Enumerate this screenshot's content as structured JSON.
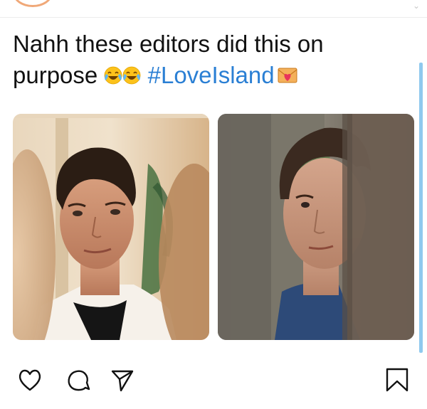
{
  "post": {
    "caption_text": "Nahh these editors did this on purpose",
    "hashtag": "#LoveIsland",
    "emojis": [
      "face-with-tears-of-joy-icon",
      "face-with-tears-of-joy-icon",
      "love-letter-icon"
    ]
  },
  "images": [
    {
      "subject": "man-in-villa-photo"
    },
    {
      "subject": "man-behind-fence-photo"
    }
  ],
  "actions": {
    "like": "heart-icon",
    "comment": "comment-bubble-icon",
    "share": "send-arrow-icon",
    "save": "bookmark-icon"
  },
  "colors": {
    "hashtag": "#2a7fd4",
    "text": "#111111",
    "scrollbar": "#8fc9ee",
    "avatar_ring": "#f0a878"
  }
}
